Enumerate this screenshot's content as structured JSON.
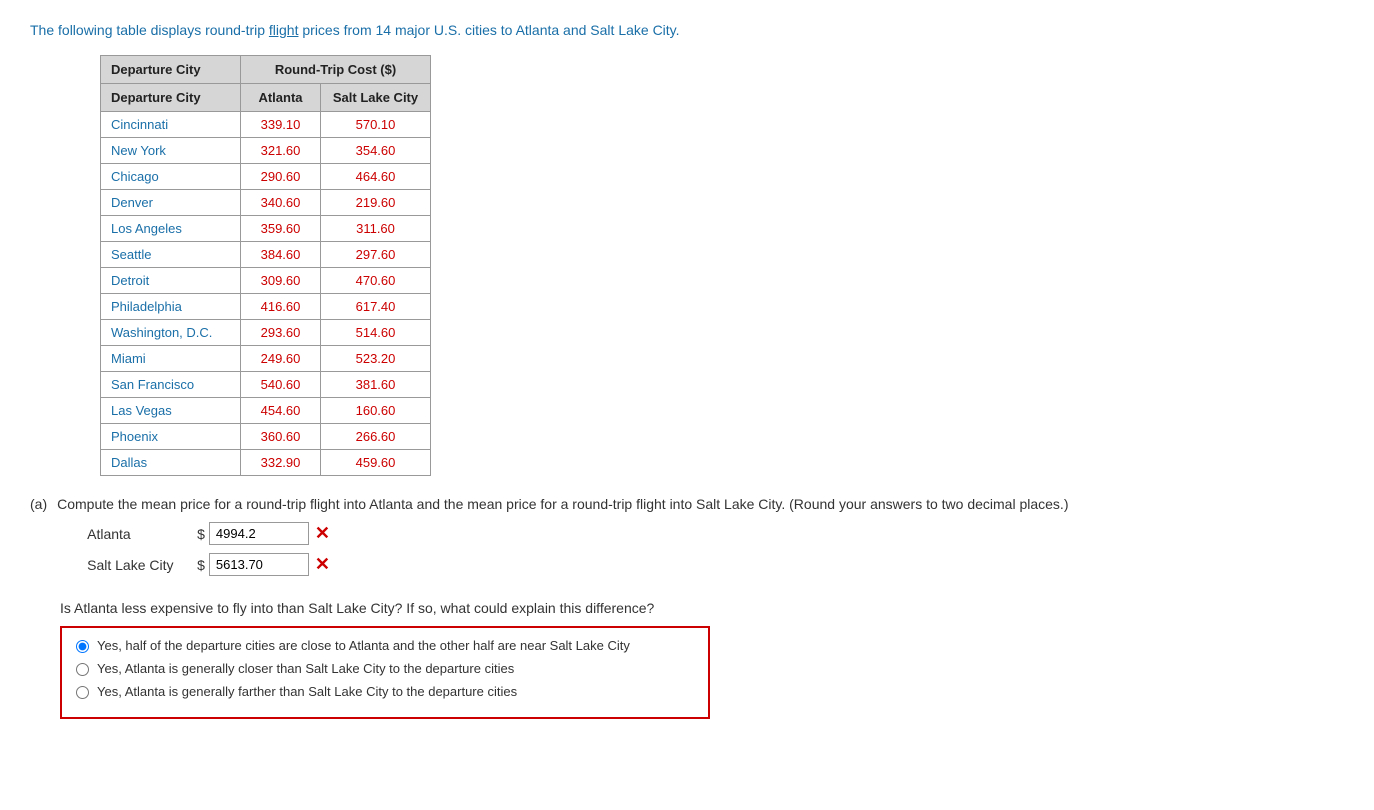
{
  "intro": {
    "text_before": "The following table displays round-trip flight prices from ",
    "link_count": "14",
    "text_middle": " major U.S. cities to Atlanta and Salt Lake City.",
    "link_text": "flight",
    "link2_text": "U.S."
  },
  "table": {
    "header_col1": "Departure City",
    "header_roundtrip": "Round-Trip Cost ($)",
    "header_atlanta": "Atlanta",
    "header_slc": "Salt Lake City",
    "rows": [
      {
        "city": "Cincinnati",
        "atlanta": "339.10",
        "slc": "570.10"
      },
      {
        "city": "New York",
        "atlanta": "321.60",
        "slc": "354.60"
      },
      {
        "city": "Chicago",
        "atlanta": "290.60",
        "slc": "464.60"
      },
      {
        "city": "Denver",
        "atlanta": "340.60",
        "slc": "219.60"
      },
      {
        "city": "Los Angeles",
        "atlanta": "359.60",
        "slc": "311.60"
      },
      {
        "city": "Seattle",
        "atlanta": "384.60",
        "slc": "297.60"
      },
      {
        "city": "Detroit",
        "atlanta": "309.60",
        "slc": "470.60"
      },
      {
        "city": "Philadelphia",
        "atlanta": "416.60",
        "slc": "617.40"
      },
      {
        "city": "Washington, D.C.",
        "atlanta": "293.60",
        "slc": "514.60"
      },
      {
        "city": "Miami",
        "atlanta": "249.60",
        "slc": "523.20"
      },
      {
        "city": "San Francisco",
        "atlanta": "540.60",
        "slc": "381.60"
      },
      {
        "city": "Las Vegas",
        "atlanta": "454.60",
        "slc": "160.60"
      },
      {
        "city": "Phoenix",
        "atlanta": "360.60",
        "slc": "266.60"
      },
      {
        "city": "Dallas",
        "atlanta": "332.90",
        "slc": "459.60"
      }
    ]
  },
  "part_a": {
    "label": "(a)",
    "question": "Compute the mean price for a round-trip flight into Atlanta and the mean price for a round-trip flight into Salt Lake City. (Round your answers to two decimal places.)",
    "atlanta_label": "Atlanta",
    "slc_label": "Salt Lake City",
    "dollar": "$",
    "atlanta_value": "4994.2",
    "slc_value": "5613.70",
    "x_mark": "✕"
  },
  "question_b": {
    "text": "Is Atlanta less expensive to fly into than Salt Lake City? If so, what could explain this difference?",
    "options": [
      "Yes, half of the departure cities are close to Atlanta and the other half are near Salt Lake City",
      "Yes, Atlanta is generally closer than Salt Lake City to the departure cities",
      "Yes, Atlanta is generally farther than Salt Lake City to the departure cities"
    ],
    "selected_index": 0
  }
}
